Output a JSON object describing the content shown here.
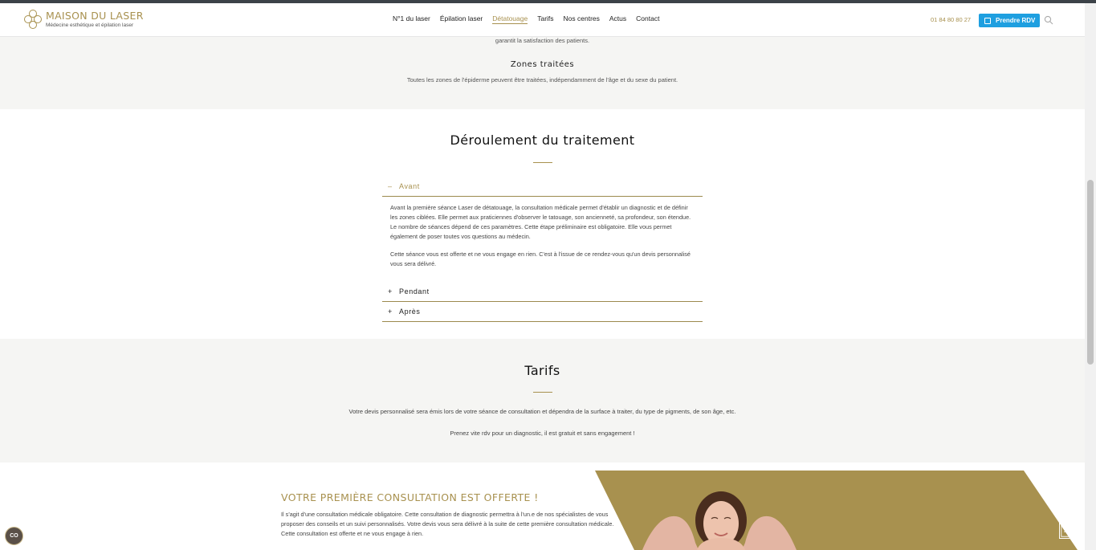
{
  "brand": {
    "title": "MAISON DU LASER",
    "subtitle": "Médecine esthétique et épilation laser"
  },
  "nav": {
    "items": [
      "N°1 du laser",
      "Épilation laser",
      "Détatouage",
      "Tarifs",
      "Nos centres",
      "Actus",
      "Contact"
    ],
    "active_index": 2
  },
  "header": {
    "phone": "01 84 80 80 27",
    "rdv_label": "Prendre RDV"
  },
  "zones": {
    "intro_tail": "garantit la satisfaction des patients.",
    "title": "Zones traitées",
    "text": "Toutes les zones de l'épiderme peuvent être traitées, indépendamment de l'âge et du sexe du patient."
  },
  "deroulement": {
    "title": "Déroulement du traitement",
    "accordion": [
      {
        "sign": "–",
        "label": "Avant",
        "open": true,
        "paragraphs": [
          "Avant la première séance Laser de détatouage, la consultation médicale permet d'établir un diagnostic et de définir les zones ciblées. Elle permet aux praticiennes d'observer le tatouage, son ancienneté, sa profondeur, son étendue. Le nombre de séances dépend de ces paramètres. Cette étape préliminaire est obligatoire. Elle vous permet également de poser toutes vos questions au médecin.",
          "Cette séance vous est offerte et ne vous engage en rien. C'est à l'issue de ce rendez-vous qu'un devis personnalisé vous sera délivré."
        ]
      },
      {
        "sign": "+",
        "label": "Pendant",
        "open": false
      },
      {
        "sign": "+",
        "label": "Après",
        "open": false
      }
    ]
  },
  "tarifs": {
    "title": "Tarifs",
    "text1": "Votre devis personnalisé sera émis lors de votre séance de consultation et dépendra de la surface à traiter, du type de pigments, de son âge, etc.",
    "text2": "Prenez vite rdv pour un diagnostic, il est gratuit et sans engagement !"
  },
  "promo": {
    "title": "VOTRE PREMIÈRE CONSULTATION EST OFFERTE !",
    "text": "Il s'agit d'une consultation médicale obligatoire. Cette consultation de diagnostic permettra à l'un.e de nos spécialistes de vous proposer des conseils et un suivi personnalisés. Votre devis vous sera délivré à la suite de cette première consultation médicale. Cette consultation est offerte et ne vous engage à rien."
  },
  "cookie_badge": "CO",
  "colors": {
    "gold": "#a8914f",
    "blue": "#1e9fe0",
    "light_bg": "#f5f5f3"
  },
  "icons": [
    "logo-flower-icon",
    "calendar-icon",
    "search-icon",
    "scroll-top-icon",
    "cookie-icon"
  ]
}
